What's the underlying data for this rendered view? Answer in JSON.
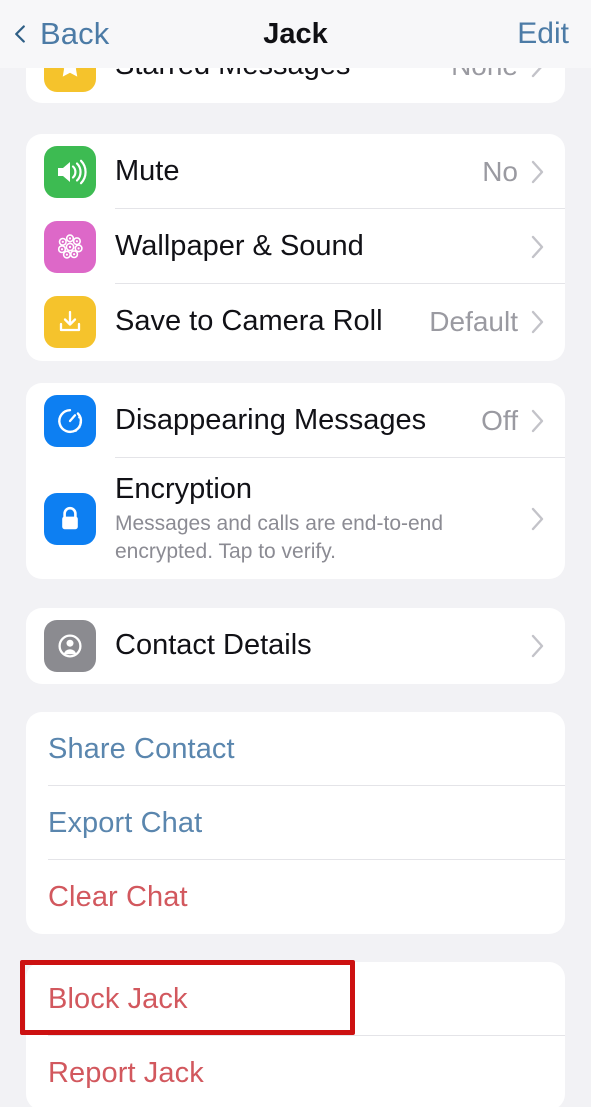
{
  "nav": {
    "back_label": "Back",
    "title": "Jack",
    "edit_label": "Edit"
  },
  "colors": {
    "background": "#f2f2f5",
    "card": "#ffffff",
    "nav_tint": "#4c7ba6",
    "link_blue": "#5a86ae",
    "destructive_red": "#d2585e",
    "highlight_box": "#cc1111",
    "icon_green": "#3dbb52",
    "icon_pink": "#dd68c8",
    "icon_yellow": "#f5c32c",
    "icon_blue": "#0d7ff2",
    "icon_gray": "#8b8b90",
    "value_gray": "#9a9aa1",
    "separator": "#e4e4e8"
  },
  "sections": [
    {
      "id": "starred-section",
      "clipped": true,
      "rows": [
        {
          "name": "starred-messages",
          "icon": "star-icon",
          "icon_color": "#f5c32c",
          "label": "Starred Messages",
          "value": "None",
          "chevron": true
        }
      ]
    },
    {
      "id": "chat-settings-section",
      "rows": [
        {
          "name": "mute",
          "icon": "speaker-wave-icon",
          "icon_color": "#3dbb52",
          "label": "Mute",
          "value": "No",
          "chevron": true
        },
        {
          "name": "wallpaper-and-sound",
          "icon": "flower-rosette-icon",
          "icon_color": "#dd68c8",
          "label": "Wallpaper & Sound",
          "value": "",
          "chevron": true
        },
        {
          "name": "save-to-camera-roll",
          "icon": "download-tray-icon",
          "icon_color": "#f5c32c",
          "label": "Save to Camera Roll",
          "value": "Default",
          "chevron": true
        }
      ]
    },
    {
      "id": "privacy-section",
      "rows": [
        {
          "name": "disappearing-messages",
          "icon": "timer-dotted-icon",
          "icon_color": "#0d7ff2",
          "label": "Disappearing Messages",
          "value": "Off",
          "chevron": true
        },
        {
          "name": "encryption",
          "icon": "lock-icon",
          "icon_color": "#0d7ff2",
          "label": "Encryption",
          "sublabel": "Messages and calls are end-to-end encrypted. Tap to verify.",
          "value": "",
          "chevron": true
        }
      ]
    },
    {
      "id": "contact-section",
      "rows": [
        {
          "name": "contact-details",
          "icon": "contact-person-icon",
          "icon_color": "#8b8b90",
          "label": "Contact Details",
          "value": "",
          "chevron": true
        }
      ]
    },
    {
      "id": "actions-section",
      "actions": [
        {
          "name": "share-contact",
          "label": "Share Contact",
          "style": "blue"
        },
        {
          "name": "export-chat",
          "label": "Export Chat",
          "style": "blue"
        },
        {
          "name": "clear-chat",
          "label": "Clear Chat",
          "style": "red"
        }
      ]
    },
    {
      "id": "block-report-section",
      "actions": [
        {
          "name": "block-jack",
          "label": "Block Jack",
          "style": "red",
          "highlighted": true
        },
        {
          "name": "report-jack",
          "label": "Report Jack",
          "style": "red"
        }
      ]
    }
  ],
  "annotation": {
    "name": "block-jack-highlight",
    "target": "block-jack",
    "color": "#cc1111"
  }
}
